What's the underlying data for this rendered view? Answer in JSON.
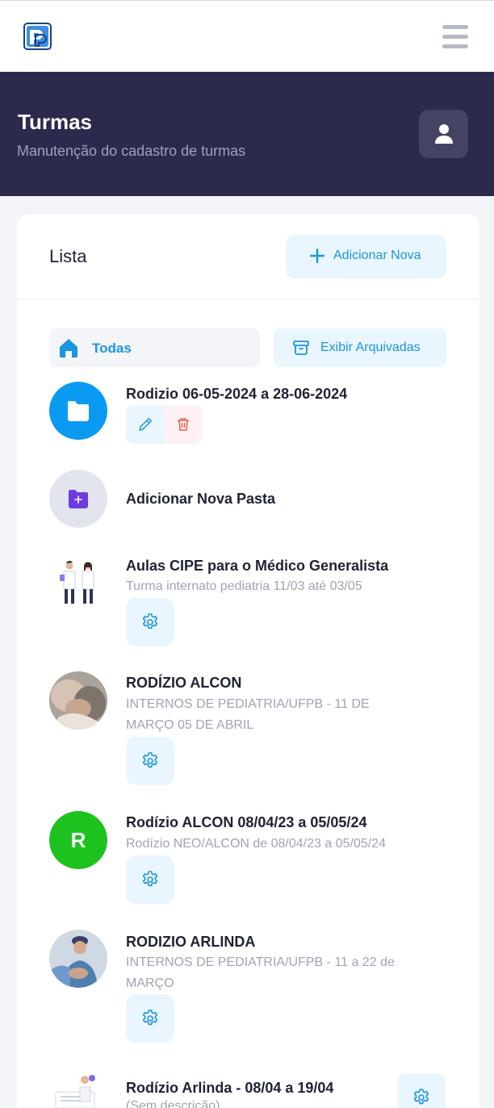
{
  "header": {
    "title": "Turmas",
    "subtitle": "Manutenção do cadastro de turmas"
  },
  "card": {
    "title": "Lista",
    "add_button_label": "Adicionar Nova"
  },
  "tabs": {
    "all_label": "Todas",
    "archived_label": "Exibir Arquivadas"
  },
  "items": [
    {
      "title": "Rodizio 06-05-2024 a 28-06-2024",
      "description": ""
    },
    {
      "title": "Adicionar Nova Pasta",
      "description": ""
    },
    {
      "title": "Aulas CIPE para o Médico Generalista",
      "description": "Turma internato pediatria 11/03 até 03/05"
    },
    {
      "title": "RODÍZIO ALCON",
      "description": "INTERNOS DE PEDIATRIA/UFPB - 11 DE MARÇO 05 DE ABRIL"
    },
    {
      "title": "Rodízio ALCON 08/04/23 a 05/05/24",
      "description": "Rodízio NEO/ALCON de 08/04/23 a 05/05/24",
      "avatar_letter": "R"
    },
    {
      "title": "RODIZIO ARLINDA",
      "description": "INTERNOS DE PEDIATRIA/UFPB - 11 a 22 de MARÇO"
    },
    {
      "title": "Rodízio Arlinda - 08/04 a 19/04",
      "description": "(Sem descrição)"
    }
  ],
  "colors": {
    "accent": "#1a95e0",
    "banner_bg": "#2b2a4c",
    "folder_blue": "#0b9af2",
    "green_avatar": "#1ec21e",
    "delete_red": "#e0654f"
  },
  "icons": {
    "logo": "app-logo",
    "menu": "hamburger-icon",
    "user": "user-icon",
    "add": "plus-icon",
    "home": "home-icon",
    "archive": "archive-icon",
    "folder": "folder-icon",
    "folder_add": "folder-plus-icon",
    "edit": "pencil-icon",
    "delete": "trash-icon",
    "settings": "gear-icon"
  }
}
